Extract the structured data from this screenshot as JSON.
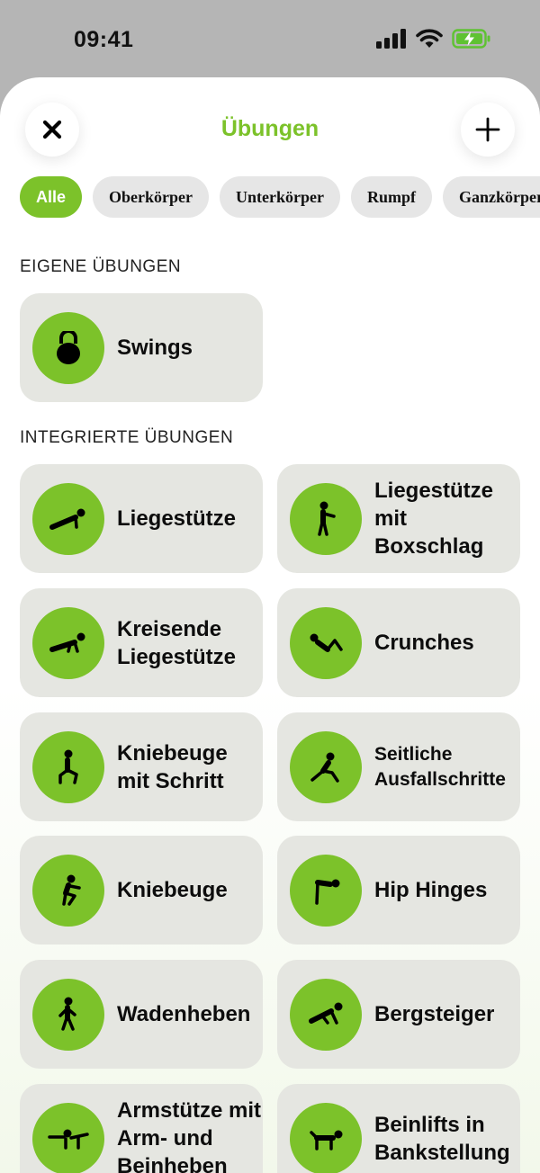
{
  "status": {
    "time": "09:41"
  },
  "header": {
    "title": "Übungen"
  },
  "filters": [
    "Alle",
    "Oberkörper",
    "Unterkörper",
    "Rumpf",
    "Ganzkörper"
  ],
  "sections": {
    "own": {
      "title": "EIGENE ÜBUNGEN"
    },
    "builtin": {
      "title": "INTEGRIERTE ÜBUNGEN"
    }
  },
  "own_exercises": [
    {
      "label": "Swings",
      "icon": "kettlebell-icon"
    }
  ],
  "exercises": [
    {
      "label": "Liegestütze",
      "icon": "push-up-icon"
    },
    {
      "label": "Liegestütze mit Boxschlag",
      "icon": "boxing-icon"
    },
    {
      "label": "Kreisende Liegestütze",
      "icon": "push-up-icon"
    },
    {
      "label": "Crunches",
      "icon": "crunch-icon"
    },
    {
      "label": "Kniebeuge mit Schritt",
      "icon": "lunge-icon"
    },
    {
      "label": "Seitliche Ausfallschritte",
      "icon": "side-lunge-icon"
    },
    {
      "label": "Kniebeuge",
      "icon": "squat-icon"
    },
    {
      "label": "Hip Hinges",
      "icon": "hip-hinge-icon"
    },
    {
      "label": "Wadenheben",
      "icon": "calf-raise-icon"
    },
    {
      "label": "Bergsteiger",
      "icon": "mountain-climber-icon"
    },
    {
      "label": "Armstütze mit Arm- und Beinheben",
      "icon": "plank-reach-icon"
    },
    {
      "label": "Beinlifts in Bankstellung",
      "icon": "leg-lift-icon"
    }
  ],
  "colors": {
    "accent": "#7cc22a",
    "card": "#e5e6e1",
    "chip": "#e6e6e6",
    "battery": "#5fc232"
  }
}
